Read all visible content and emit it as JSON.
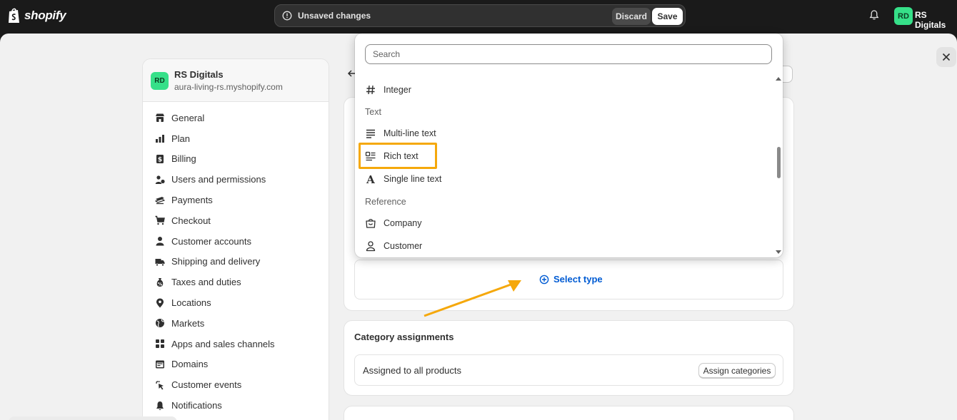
{
  "topbar": {
    "brand": "shopify",
    "unsaved_text": "Unsaved changes",
    "discard_label": "Discard",
    "save_label": "Save",
    "avatar_initials": "RD",
    "store_name": "RS Digitals"
  },
  "sidebar": {
    "avatar_initials": "RD",
    "store_name": "RS Digitals",
    "store_domain": "aura-living-rs.myshopify.com",
    "items": [
      {
        "label": "General",
        "icon": "store-icon"
      },
      {
        "label": "Plan",
        "icon": "plan-icon"
      },
      {
        "label": "Billing",
        "icon": "billing-icon"
      },
      {
        "label": "Users and permissions",
        "icon": "users-icon"
      },
      {
        "label": "Payments",
        "icon": "payments-icon"
      },
      {
        "label": "Checkout",
        "icon": "cart-icon"
      },
      {
        "label": "Customer accounts",
        "icon": "person-icon"
      },
      {
        "label": "Shipping and delivery",
        "icon": "truck-icon"
      },
      {
        "label": "Taxes and duties",
        "icon": "tax-icon"
      },
      {
        "label": "Locations",
        "icon": "location-icon"
      },
      {
        "label": "Markets",
        "icon": "globe-icon"
      },
      {
        "label": "Apps and sales channels",
        "icon": "apps-icon"
      },
      {
        "label": "Domains",
        "icon": "domains-icon"
      },
      {
        "label": "Customer events",
        "icon": "events-icon"
      },
      {
        "label": "Notifications",
        "icon": "bell-icon"
      }
    ]
  },
  "dropdown": {
    "search_placeholder": "Search",
    "options": [
      {
        "label": "Integer",
        "icon": "hash-icon"
      },
      {
        "label": "Multi-line text",
        "icon": "multiline-text-icon"
      },
      {
        "label": "Rich text",
        "icon": "rich-text-icon"
      },
      {
        "label": "Single line text",
        "icon": "single-line-text-icon"
      },
      {
        "label": "Company",
        "icon": "company-icon"
      },
      {
        "label": "Customer",
        "icon": "customer-icon"
      }
    ],
    "groups": {
      "text": "Text",
      "reference": "Reference"
    },
    "highlight_color": "#f5a80b"
  },
  "definition": {
    "select_type_label": "Select type"
  },
  "category": {
    "title": "Category assignments",
    "assigned_text": "Assigned to all products",
    "assign_button": "Assign categories"
  },
  "colors": {
    "accent_link": "#005bd3",
    "annotation": "#f5a80b",
    "avatar": "#36e089"
  }
}
